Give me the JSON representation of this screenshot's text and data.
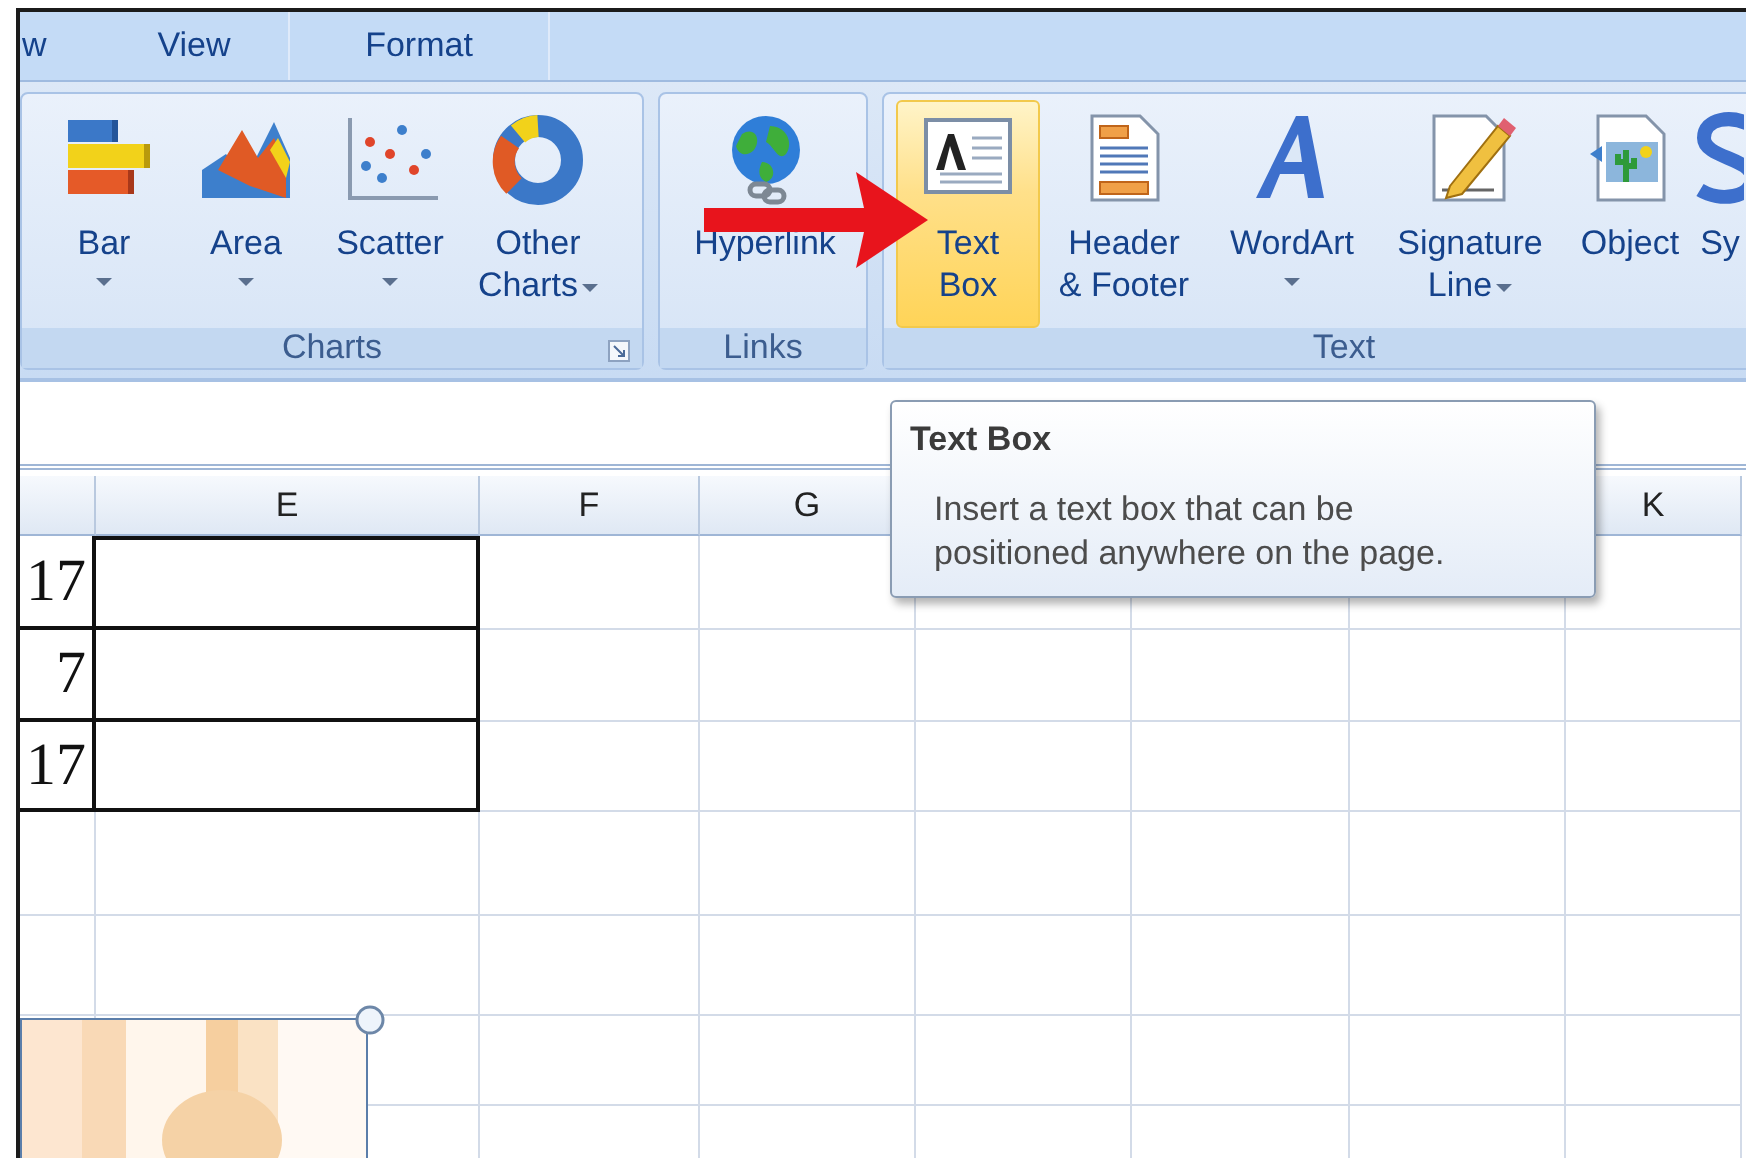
{
  "tabs": [
    {
      "label": "w",
      "selected": false
    },
    {
      "label": "View",
      "selected": false
    },
    {
      "label": "Format",
      "selected": false
    }
  ],
  "ribbon_groups": [
    {
      "label": "Charts",
      "launcher": true,
      "commands": [
        {
          "kind": "bar",
          "lines": [
            "Bar"
          ],
          "dropdown": true,
          "highlighted": false
        },
        {
          "kind": "area",
          "lines": [
            "Area"
          ],
          "dropdown": true,
          "highlighted": false
        },
        {
          "kind": "scatter",
          "lines": [
            "Scatter"
          ],
          "dropdown": true,
          "highlighted": false
        },
        {
          "kind": "donut",
          "lines": [
            "Other",
            "Charts"
          ],
          "dropdown": true,
          "highlighted": false
        }
      ]
    },
    {
      "label": "Links",
      "launcher": false,
      "commands": [
        {
          "kind": "globe",
          "lines": [
            "Hyperlink"
          ],
          "dropdown": false,
          "highlighted": false
        }
      ]
    },
    {
      "label": "Text",
      "launcher": false,
      "commands": [
        {
          "kind": "textbox",
          "lines": [
            "Text",
            "Box"
          ],
          "dropdown": false,
          "highlighted": true
        },
        {
          "kind": "header",
          "lines": [
            "Header",
            "& Footer"
          ],
          "dropdown": false,
          "highlighted": false
        },
        {
          "kind": "wordart",
          "lines": [
            "WordArt"
          ],
          "dropdown": true,
          "highlighted": false
        },
        {
          "kind": "signature",
          "lines": [
            "Signature",
            "Line"
          ],
          "dropdown": true,
          "highlighted": false
        },
        {
          "kind": "object",
          "lines": [
            "Object"
          ],
          "dropdown": false,
          "highlighted": false
        },
        {
          "kind": "symbol",
          "lines": [
            "Sy"
          ],
          "dropdown": false,
          "highlighted": false
        }
      ]
    }
  ],
  "sheet": {
    "columns": [
      {},
      {
        "header": "E"
      },
      {
        "header": "F"
      },
      {
        "header": "G"
      },
      {},
      {},
      {},
      {
        "header": "K"
      }
    ],
    "rows": [
      {
        "cells": [
          "17"
        ],
        "bordered": true
      },
      {
        "cells": [
          "7"
        ],
        "bordered": true
      },
      {
        "cells": [
          "17"
        ],
        "bordered": true
      },
      {
        "bordered": false
      },
      {
        "bordered": false
      },
      {
        "bordered": false
      },
      {
        "bordered": false
      }
    ],
    "picture": {
      "kind": "picture",
      "selected": true
    }
  },
  "tooltip": {
    "title": "Text Box",
    "body": "Insert a text box that can be positioned anywhere on the page."
  }
}
